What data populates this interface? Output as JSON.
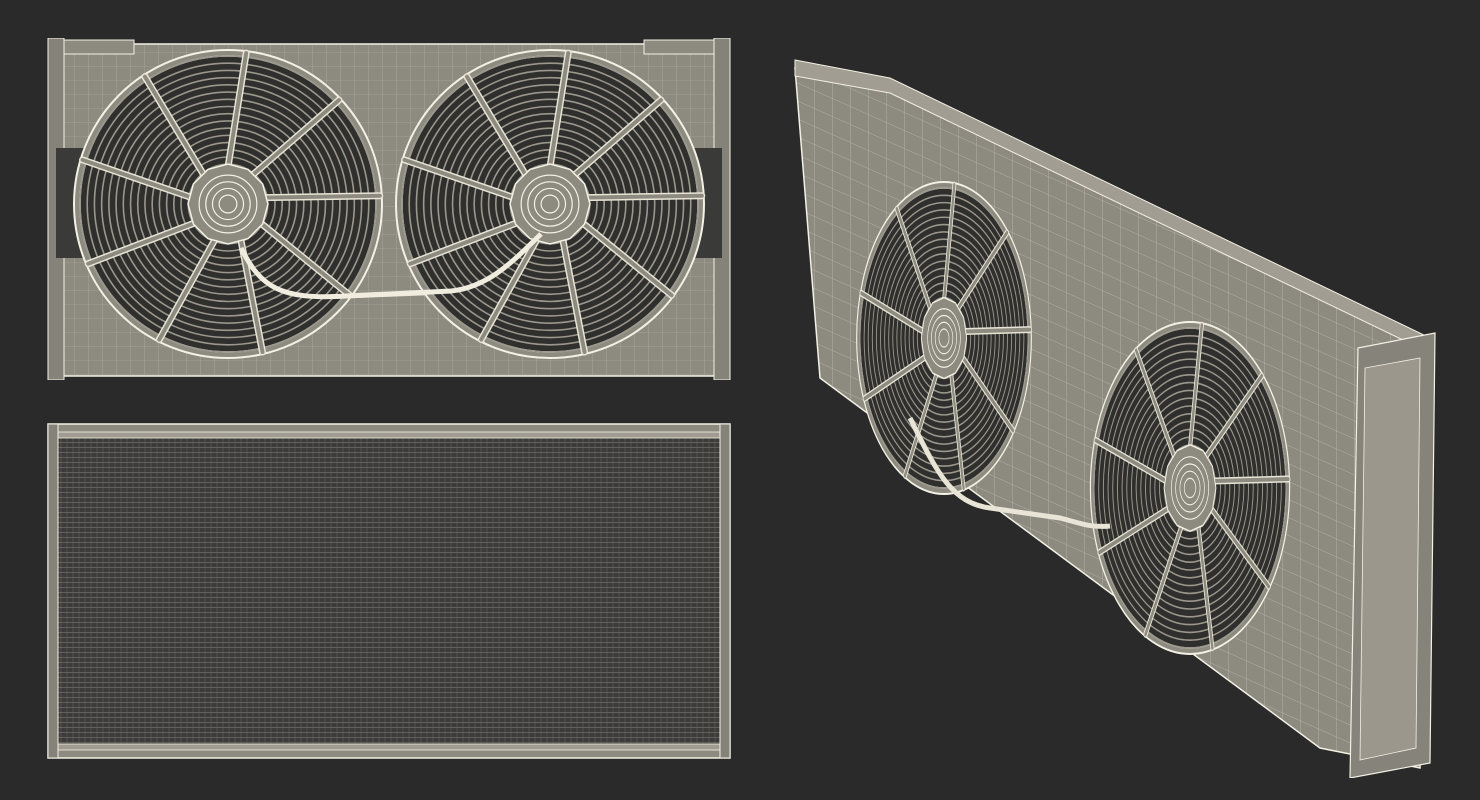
{
  "scene": {
    "background": "#2a2a2a",
    "wire_color": "#f3f1e4",
    "surface_color": "#8d8a80",
    "dark_color": "#2e2e2c"
  },
  "views": [
    {
      "id": "front",
      "shows": "radiator-with-twin-fans-front"
    },
    {
      "id": "back",
      "shows": "radiator-core-back"
    },
    {
      "id": "perspective",
      "shows": "radiator-with-twin-fans-3-4"
    }
  ]
}
